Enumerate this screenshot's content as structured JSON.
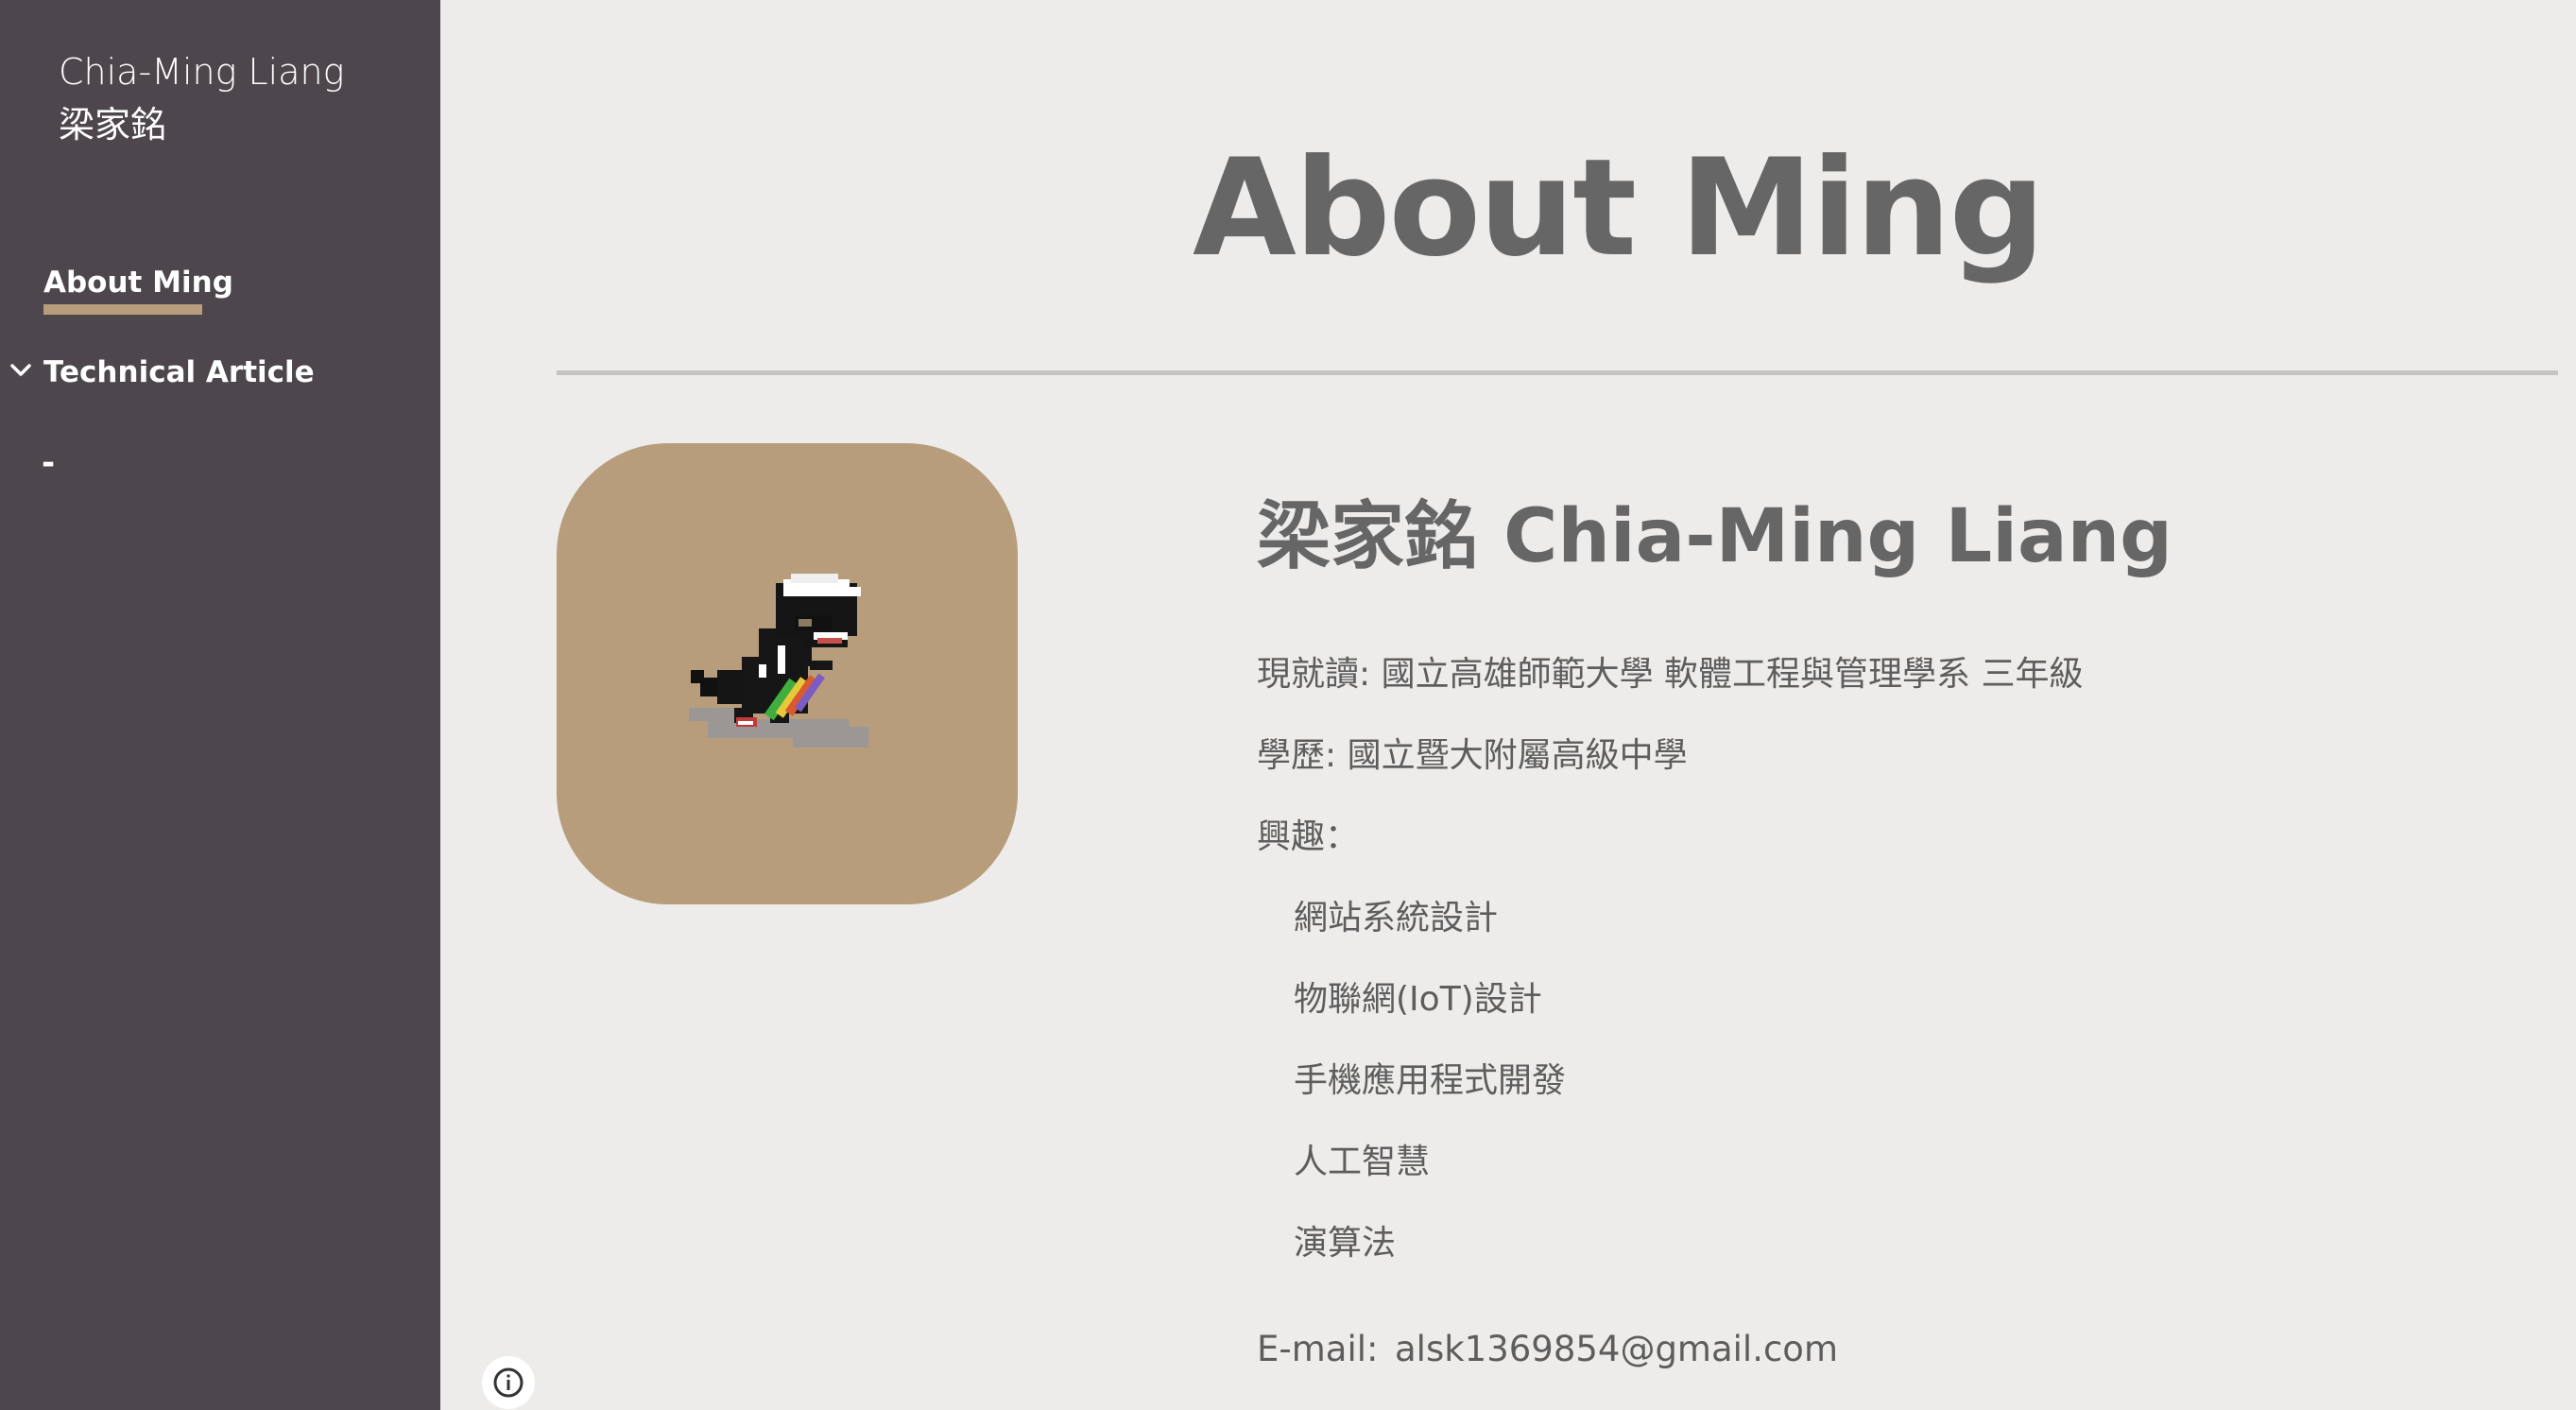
{
  "sidebar": {
    "site_title_en": "Chia-Ming Liang",
    "site_title_zh": "梁家銘",
    "nav": {
      "about": "About Ming",
      "technical": "Technical Article",
      "dash": "-"
    },
    "accent_color": "#b89d7d",
    "background_color": "#4d464c"
  },
  "main": {
    "page_title": "About Ming",
    "name_heading": "梁家銘 Chia-Ming Liang",
    "current_study": "現就讀: 國立高雄師範大學 軟體工程與管理學系 三年級",
    "education": "學歷: 國立暨大附屬高級中學",
    "interests_label": "興趣：",
    "interests": [
      "網站系統設計",
      "物聯網(IoT)設計",
      "手機應用程式開發",
      "人工智慧",
      "演算法"
    ],
    "email_label": "E-mail:",
    "email_value": "alsk1369854@gmail.com",
    "avatar_icon": "pixel-dinosaur-skateboard-icon",
    "info_icon": "info-circle-icon"
  }
}
